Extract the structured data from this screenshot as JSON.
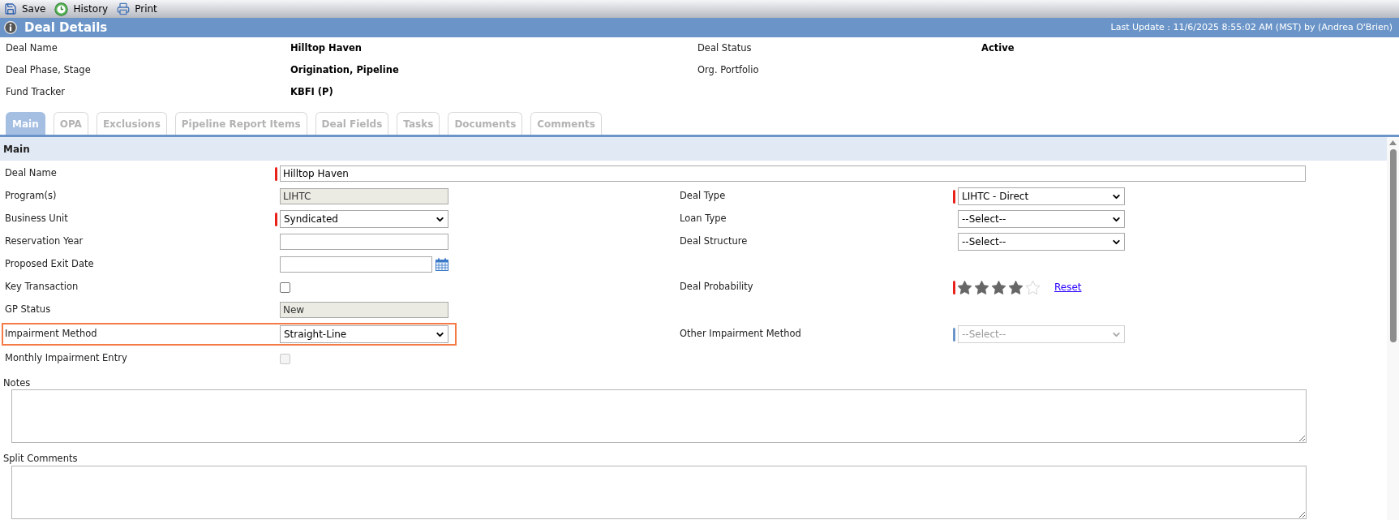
{
  "toolbar": [
    {
      "label": "Save",
      "kind": "save"
    },
    {
      "label": "History",
      "kind": "history"
    },
    {
      "label": "Print",
      "kind": "print"
    }
  ],
  "header": {
    "title": "Deal Details",
    "last_update": "Last Update : 11/6/2025 8:55:02 AM (MST) by (Andrea O'Brien)"
  },
  "summary": [
    [
      {
        "label": "Deal Name",
        "value": "Hilltop Haven"
      },
      {
        "label": "Deal Status",
        "value": "Active"
      }
    ],
    [
      {
        "label": "Deal Phase, Stage",
        "value": "Origination, Pipeline"
      },
      {
        "label": "Org. Portfolio"
      }
    ],
    [
      {
        "label": "Fund Tracker",
        "value": "KBFI (P)"
      }
    ]
  ],
  "tabs": [
    {
      "label": "Main",
      "selected": true
    },
    {
      "label": "OPA",
      "selected": false
    },
    {
      "label": "Exclusions",
      "selected": false
    },
    {
      "label": "Pipeline Report Items",
      "selected": false
    },
    {
      "label": "Deal Fields",
      "selected": false
    },
    {
      "label": "Tasks",
      "selected": false
    },
    {
      "label": "Documents",
      "selected": false
    },
    {
      "label": "Comments",
      "selected": false
    }
  ],
  "section": {
    "title": "Main",
    "rows": [
      {
        "wide": true,
        "left": {
          "label": "Deal Name",
          "kind": "text",
          "value": "Hilltop Haven",
          "marker": {
            "color": "#e8221b"
          }
        }
      },
      {
        "left": {
          "label": "Program(s)",
          "kind": "readonly",
          "value": "LIHTC"
        },
        "right": {
          "label": "Deal Type",
          "kind": "select",
          "value": "LIHTC - Direct",
          "marker": {
            "color": "#e8221b"
          },
          "disabled": false
        }
      },
      {
        "left": {
          "label": "Business Unit",
          "kind": "select",
          "value": "Syndicated",
          "marker": {
            "color": "#e8221b"
          },
          "disabled": false
        },
        "right": {
          "label": "Loan Type",
          "kind": "select",
          "value": "--Select--",
          "disabled": false
        }
      },
      {
        "left": {
          "label": "Reservation Year",
          "kind": "text"
        },
        "right": {
          "label": "Deal Structure",
          "kind": "select",
          "value": "--Select--",
          "disabled": false
        }
      },
      {
        "left": {
          "label": "Proposed Exit Date",
          "kind": "date"
        }
      },
      {
        "left": {
          "label": "Key Transaction",
          "kind": "checkbox",
          "checked": false,
          "disabled": false
        },
        "right": {
          "label": "Deal Probability",
          "kind": "rating",
          "stars": 4,
          "marker": {
            "color": "#e8221b"
          },
          "link": "Reset"
        }
      },
      {
        "left": {
          "label": "GP Status",
          "kind": "readonly",
          "value": "New"
        }
      },
      {
        "left": {
          "label": "Impairment Method",
          "kind": "select",
          "value": "Straight-Line",
          "disabled": false,
          "highlighted": true
        },
        "right": {
          "label": "Other Impairment Method",
          "kind": "select",
          "value": "--Select--",
          "marker": {
            "color": "#6b95c8"
          },
          "disabled": true
        }
      },
      {
        "left": {
          "label": "Monthly Impairment Entry",
          "kind": "checkbox",
          "checked": false,
          "disabled": true
        }
      }
    ],
    "text_areas": [
      {
        "label": "Notes"
      },
      {
        "label": "Split Comments"
      }
    ]
  }
}
